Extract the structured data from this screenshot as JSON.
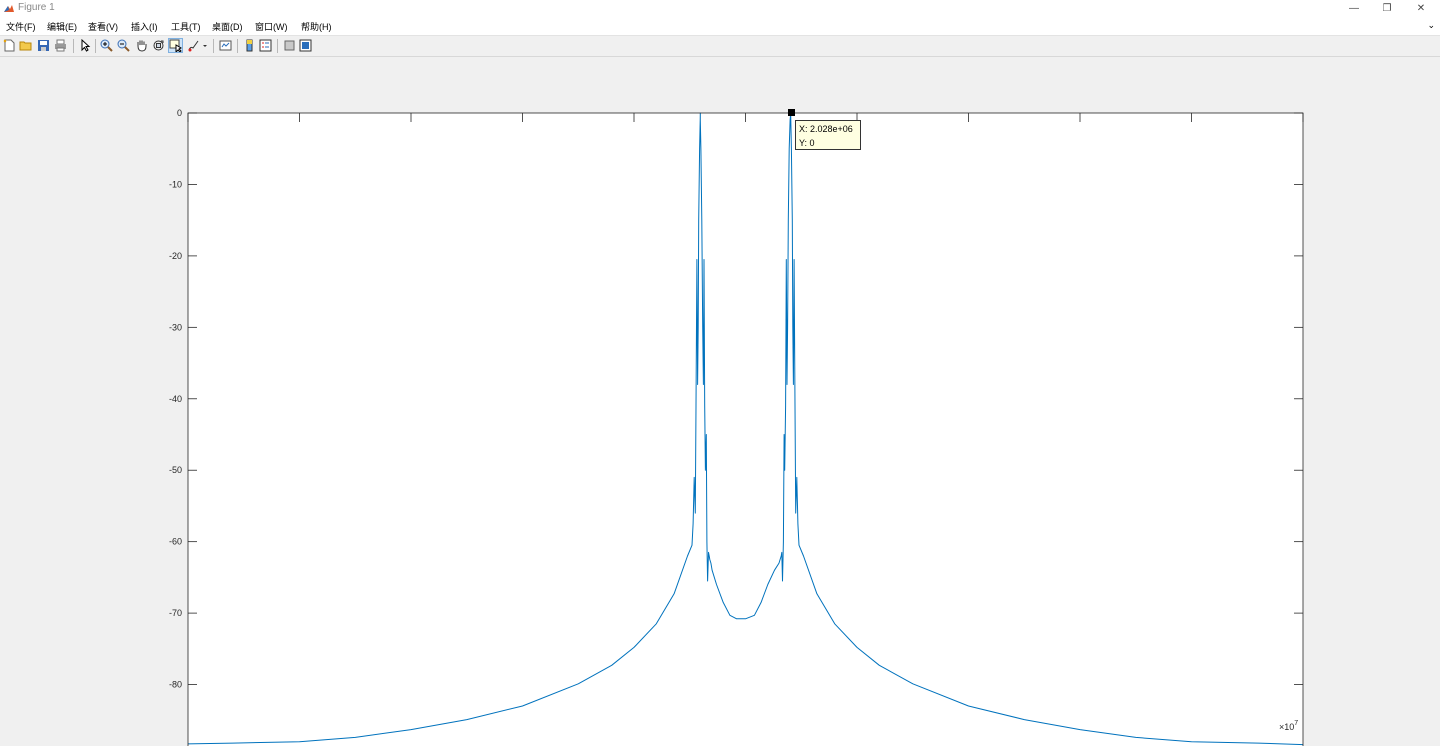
{
  "window": {
    "title": "Figure 1",
    "controls": {
      "minimize": "—",
      "restore": "❐",
      "close": "✕"
    }
  },
  "menu": {
    "items": [
      "文件(F)",
      "编辑(E)",
      "查看(V)",
      "插入(I)",
      "工具(T)",
      "桌面(D)",
      "窗口(W)",
      "帮助(H)"
    ],
    "overflow": "⌄"
  },
  "toolbar": {
    "icons": [
      "new-figure-icon",
      "open-file-icon",
      "save-icon",
      "print-icon",
      "edit-plot-arrow-icon",
      "zoom-in-icon",
      "zoom-out-icon",
      "pan-hand-icon",
      "rotate-3d-icon",
      "data-cursor-icon",
      "brush-icon",
      "link-plot-icon",
      "colorbar-icon",
      "legend-icon",
      "hide-plot-tools-icon",
      "show-plot-tools-icon"
    ]
  },
  "datatip": {
    "x_text": "X: 2.028e+06",
    "y_text": "Y: 0"
  },
  "chart_data": {
    "type": "line",
    "title": "",
    "xlabel": "",
    "ylabel": "",
    "x_exponent_label": "×10",
    "x_exponent_power": "7",
    "xlim": [
      -2.5,
      2.5
    ],
    "ylim": [
      -90,
      0
    ],
    "x_ticks": [
      "-2.5",
      "-2",
      "-1.5",
      "-1",
      "-0.5",
      "0",
      "0.5",
      "1",
      "1.5",
      "2",
      "2.5"
    ],
    "y_ticks": [
      "0",
      "-10",
      "-20",
      "-30",
      "-40",
      "-50",
      "-60",
      "-70",
      "-80",
      "-90"
    ],
    "grid": false,
    "series": [
      {
        "color": "#0072bd",
        "x": [
          -2.5,
          -2.3,
          -2.0,
          -1.75,
          -1.5,
          -1.25,
          -1.0,
          -0.75,
          -0.6,
          -0.5,
          -0.4,
          -0.32,
          -0.26,
          -0.24,
          -0.235,
          -0.23,
          -0.225,
          -0.222,
          -0.218,
          -0.215,
          -0.212,
          -0.21,
          -0.206,
          -0.203,
          -0.2028,
          -0.2025,
          -0.2,
          -0.196,
          -0.192,
          -0.189,
          -0.186,
          -0.183,
          -0.18,
          -0.176,
          -0.173,
          -0.17,
          -0.166,
          -0.163,
          -0.16,
          -0.155,
          -0.15,
          -0.13,
          -0.1,
          -0.07,
          -0.04,
          0.0,
          0.04,
          0.07,
          0.1,
          0.13,
          0.15,
          0.155,
          0.16,
          0.163,
          0.166,
          0.17,
          0.173,
          0.176,
          0.18,
          0.183,
          0.186,
          0.189,
          0.192,
          0.196,
          0.2,
          0.2025,
          0.2028,
          0.203,
          0.206,
          0.21,
          0.212,
          0.215,
          0.218,
          0.222,
          0.225,
          0.23,
          0.235,
          0.24,
          0.26,
          0.32,
          0.4,
          0.5,
          0.6,
          0.75,
          1.0,
          1.25,
          1.5,
          1.75,
          2.0,
          2.3,
          2.5
        ],
        "y": [
          -88.3,
          -88.2,
          -88.0,
          -87.4,
          -86.3,
          -84.9,
          -83.0,
          -79.9,
          -77.3,
          -74.8,
          -71.5,
          -67.3,
          -62.0,
          -60.5,
          -57.5,
          -51.0,
          -56.0,
          -41.0,
          -20.5,
          -38.0,
          -30.0,
          -15.0,
          -5.0,
          -1.0,
          0.0,
          -1.0,
          -5.0,
          -15.0,
          -30.0,
          -38.0,
          -20.5,
          -41.0,
          -50.0,
          -45.0,
          -60.0,
          -65.5,
          -61.5,
          -62.0,
          -62.5,
          -63.0,
          -64.0,
          -66.0,
          -68.5,
          -70.3,
          -70.8,
          -70.8,
          -70.3,
          -68.5,
          -66.0,
          -64.0,
          -63.0,
          -62.5,
          -62.0,
          -61.5,
          -65.5,
          -60.0,
          -45.0,
          -50.0,
          -41.0,
          -20.5,
          -38.0,
          -30.0,
          -15.0,
          -5.0,
          -1.0,
          0.0,
          0.0,
          -1.0,
          -5.0,
          -15.0,
          -30.0,
          -38.0,
          -20.5,
          -41.0,
          -56.0,
          -51.0,
          -57.5,
          -60.5,
          -62.0,
          -67.3,
          -71.5,
          -74.8,
          -77.3,
          -79.9,
          -83.0,
          -84.9,
          -86.3,
          -87.4,
          -88.0,
          -88.2,
          -88.4
        ]
      }
    ]
  }
}
